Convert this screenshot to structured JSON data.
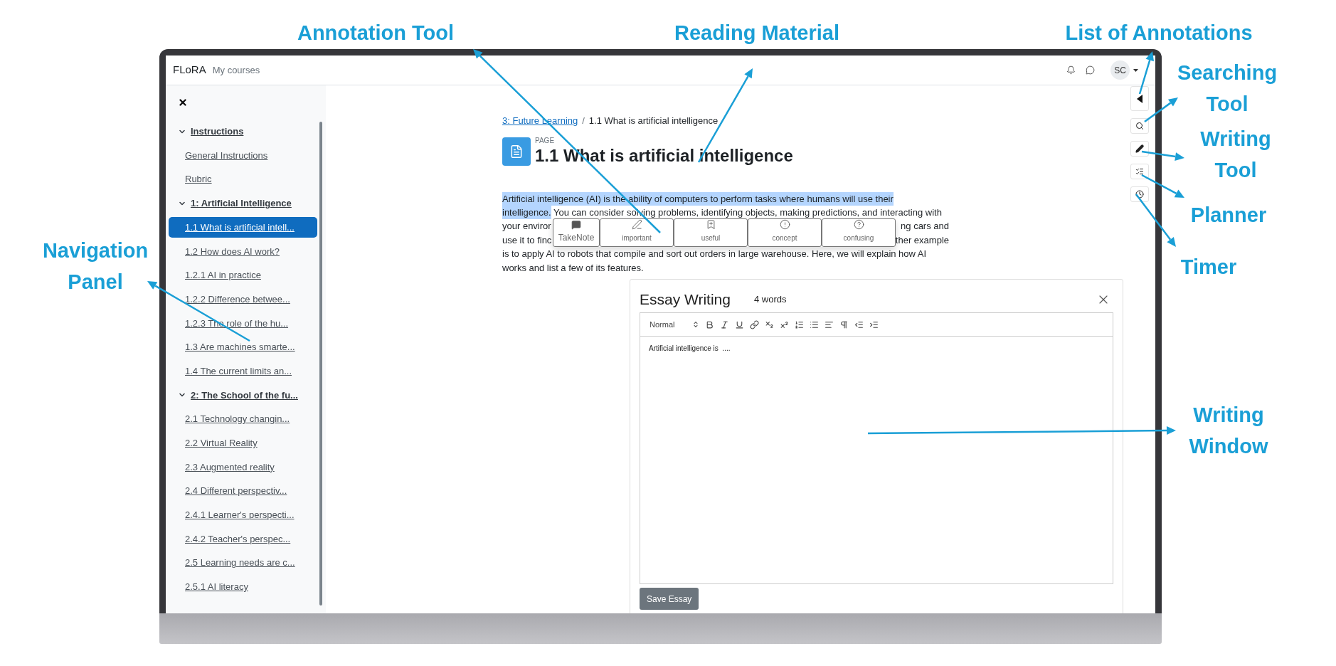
{
  "callouts": [
    {
      "text": "Annotation Tool"
    },
    {
      "text": "Reading Material"
    },
    {
      "text": "List of Annotations"
    },
    {
      "text": "Searching Tool"
    },
    {
      "text": "Writing Tool"
    },
    {
      "text": "Planner"
    },
    {
      "text": "Timer"
    },
    {
      "text": "Navigation Panel"
    },
    {
      "text": "Writing Window"
    }
  ],
  "top_bar": {
    "brand": "FLoRA",
    "nav": "My courses",
    "avatar": "SC"
  },
  "sidebar": {
    "sections": [
      {
        "title": "Instructions",
        "expanded": true,
        "children": [
          {
            "label": "General Instructions",
            "selected": false
          },
          {
            "label": "Rubric",
            "selected": false
          }
        ]
      },
      {
        "title": "1: Artificial Intelligence",
        "expanded": true,
        "children": [
          {
            "label": "1.1 What is artificial intell...",
            "selected": true
          },
          {
            "label": "1.2 How does AI work?",
            "selected": false
          },
          {
            "label": "1.2.1 AI in practice",
            "selected": false
          },
          {
            "label": "1.2.2 Difference betwee...",
            "selected": false
          },
          {
            "label": "1.2.3 The role of the hu...",
            "selected": false
          },
          {
            "label": "1.3 Are machines smarte...",
            "selected": false
          },
          {
            "label": "1.4 The current limits an...",
            "selected": false
          }
        ]
      },
      {
        "title": "2: The School of the fu...",
        "expanded": true,
        "children": [
          {
            "label": "2.1 Technology changin...",
            "selected": false
          },
          {
            "label": "2.2 Virtual Reality",
            "selected": false
          },
          {
            "label": "2.3 Augmented reality",
            "selected": false
          },
          {
            "label": "2.4 Different perspectiv...",
            "selected": false
          },
          {
            "label": "2.4.1 Learner's perspecti...",
            "selected": false
          },
          {
            "label": "2.4.2 Teacher's perspec...",
            "selected": false
          },
          {
            "label": "2.5 Learning needs are c...",
            "selected": false
          },
          {
            "label": "2.5.1 AI literacy",
            "selected": false
          }
        ]
      }
    ]
  },
  "breadcrumb": {
    "link": "3: Future Learning",
    "separator": "/",
    "current": "1.1 What is artificial intelligence"
  },
  "page": {
    "label": "PAGE",
    "title": "1.1 What is artificial intelligence"
  },
  "paragraph": [
    {
      "covered": false,
      "segments": [
        {
          "text": "Artificial intelligence (AI) is the ability of computers to perform tasks where humans will use their",
          "highlighted": true
        }
      ]
    },
    {
      "covered": false,
      "segments": [
        {
          "text": "intelligence.",
          "highlighted": true
        },
        {
          "text": " You can consider solving problems, identifying objects, making predictions, and interacting with",
          "highlighted": false
        }
      ]
    },
    {
      "covered": true,
      "segments": [
        {
          "text": "your enviror",
          "highlighted": false
        },
        {
          "text": "ng cars and",
          "highlighted": false
        }
      ]
    },
    {
      "covered": true,
      "segments": [
        {
          "text": "use it to finc",
          "highlighted": false
        },
        {
          "text": "ther example",
          "highlighted": false
        }
      ]
    },
    {
      "covered": false,
      "segments": [
        {
          "text": "is to apply AI to robots that compile and sort out orders in large warehouse. Here, we will explain how AI",
          "highlighted": false
        }
      ]
    },
    {
      "covered": false,
      "segments": [
        {
          "text": "works and list a few of its features.",
          "highlighted": false
        }
      ]
    }
  ],
  "annotation_toolbar": [
    {
      "label": "TakeNote",
      "kind": "note"
    },
    {
      "label": "important",
      "kind": "important"
    },
    {
      "label": "useful",
      "kind": "useful"
    },
    {
      "label": "concept",
      "kind": "concept"
    },
    {
      "label": "confusing",
      "kind": "confusing"
    }
  ],
  "essay": {
    "title": "Essay Writing",
    "word_count": "4 words",
    "format": "Normal",
    "content": "Artificial intelligence is  ....",
    "save": "Save Essay"
  }
}
